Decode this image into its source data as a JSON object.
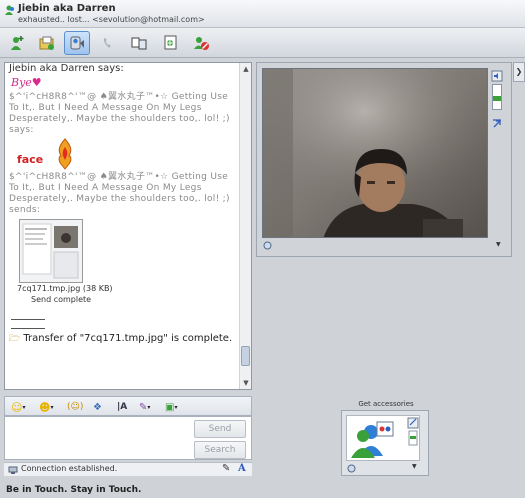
{
  "window": {
    "title": "Jiebin aka Darren",
    "subtitle": "exhausted.. lost... <sevolution@hotmail.com>"
  },
  "toolbar": {
    "buttons": [
      {
        "name": "invite-contact-icon"
      },
      {
        "name": "send-files-icon"
      },
      {
        "name": "webcam-icon"
      },
      {
        "name": "voice-call-icon"
      },
      {
        "name": "activities-icon"
      },
      {
        "name": "games-icon"
      },
      {
        "name": "block-icon"
      }
    ]
  },
  "conversation": {
    "header": "Jiebin aka Darren says:",
    "nudge_text": "Bye♥",
    "message_1": "$^'i^cH8R8^'™@ ♠翼水丸子™•☆ Getting Use To It,. But I Need A Message On My Legs Desperately,. Maybe the shoulders too,. lol! ;) says:",
    "emoticon_label": "face",
    "message_2": "$^'i^cH8R8^'™@ ♠翼水丸子™•☆ Getting Use To It,. But I Need A Message On My Legs Desperately,. Maybe the shoulders too,. lol! ;) sends:",
    "file_name": "7cq171.tmp.jpg (38 KB)",
    "file_status": "Send complete",
    "transfer_status": "Transfer of \"7cq171.tmp.jpg\" is complete."
  },
  "input": {
    "send_label": "Send",
    "search_label": "Search"
  },
  "status": {
    "text": "Connection established."
  },
  "accessories": {
    "label": "Get accessories"
  },
  "tagline": "Be in Touch. Stay in Touch.",
  "colors": {
    "accent": "#5b8ecc",
    "nudge": "#d62b8c",
    "emoticon": "#d42020"
  }
}
